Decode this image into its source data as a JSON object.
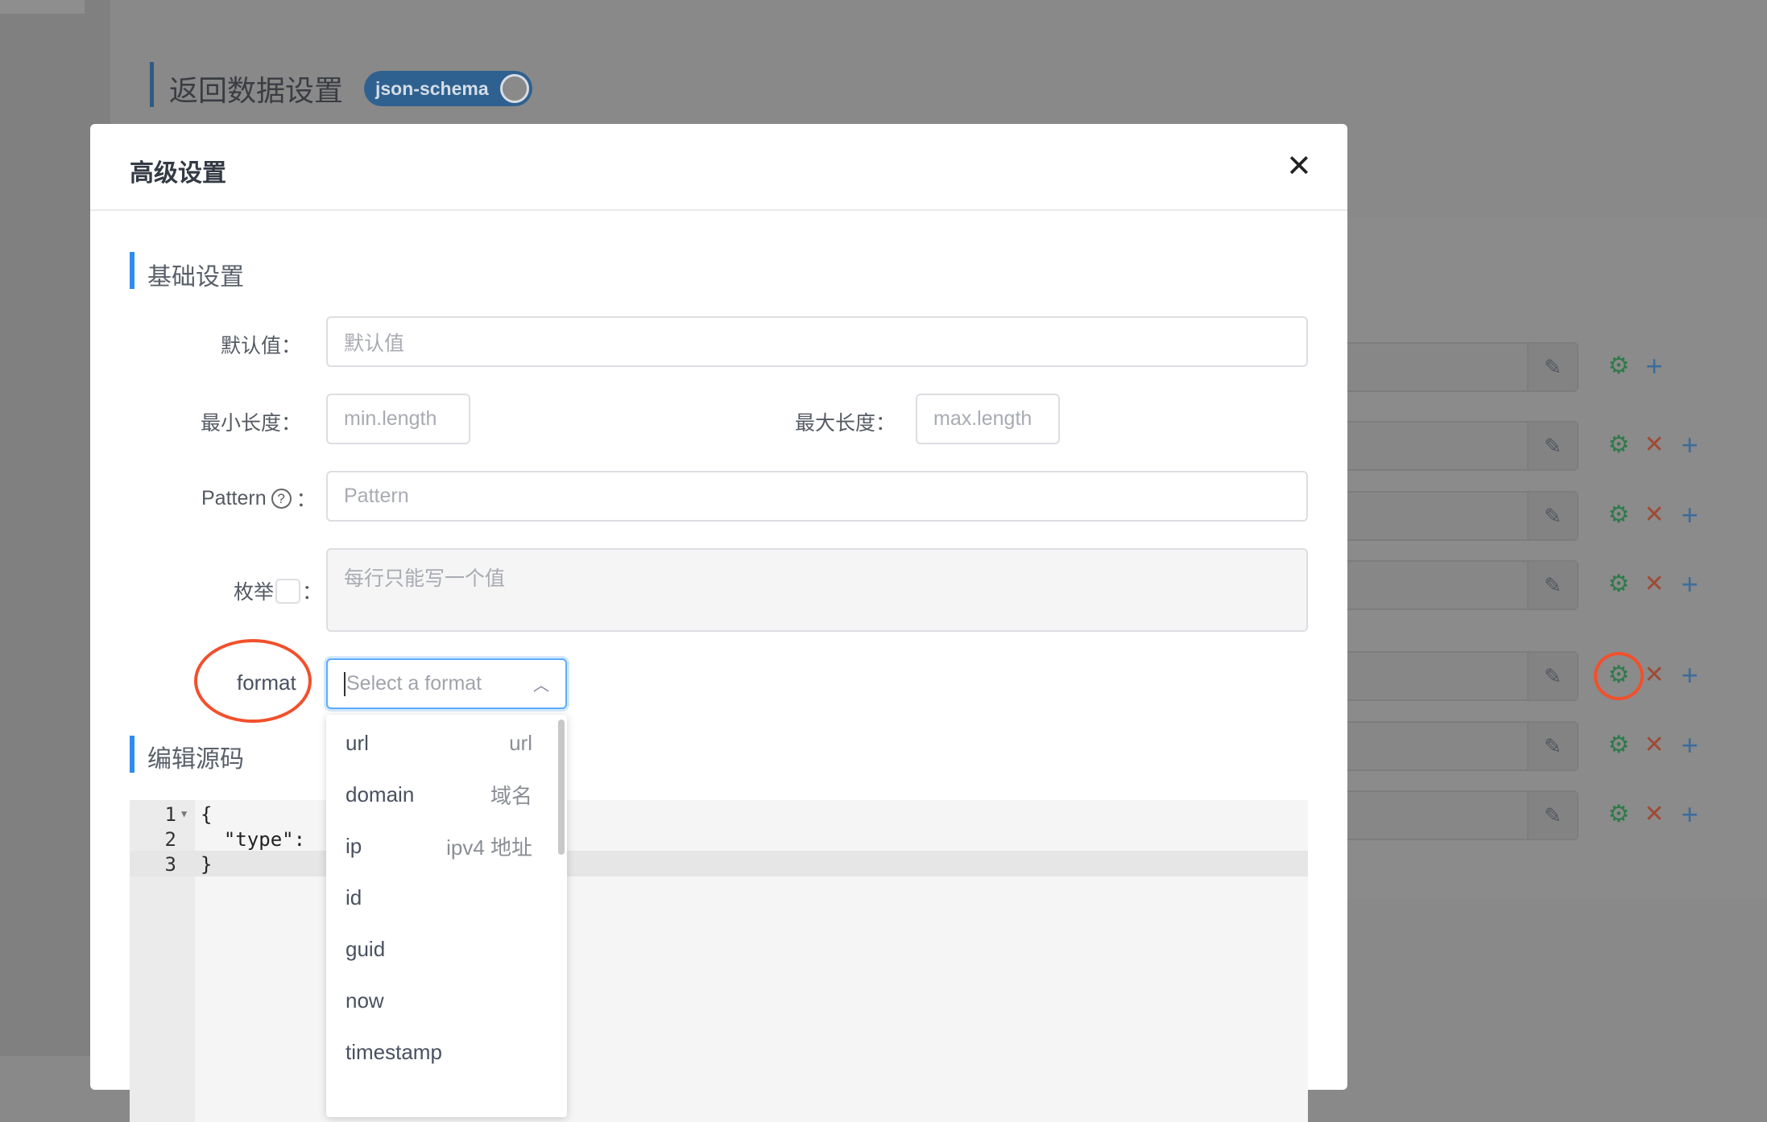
{
  "background": {
    "section_title": "返回数据设置",
    "toggle_label": "json-schema",
    "rows": [
      {
        "actions": [
          "gear-icon",
          "plus-icon"
        ]
      },
      {
        "actions": [
          "gear-icon",
          "close-icon",
          "plus-icon"
        ]
      },
      {
        "actions": [
          "gear-icon",
          "close-icon",
          "plus-icon"
        ]
      },
      {
        "actions": [
          "gear-icon",
          "close-icon",
          "plus-icon"
        ]
      },
      {
        "actions": [
          "gear-icon",
          "close-icon",
          "plus-icon"
        ],
        "highlighted": true
      },
      {
        "actions": [
          "gear-icon",
          "close-icon",
          "plus-icon"
        ]
      },
      {
        "actions": [
          "gear-icon",
          "close-icon",
          "plus-icon"
        ]
      }
    ]
  },
  "modal": {
    "title": "高级设置",
    "close": "✕",
    "basic_section": "基础设置",
    "default_label": "默认值：",
    "default_placeholder": "默认值",
    "min_label": "最小长度：",
    "min_placeholder": "min.length",
    "max_label": "最大长度：",
    "max_placeholder": "max.length",
    "pattern_label": "Pattern",
    "pattern_colon": "：",
    "pattern_placeholder": "Pattern",
    "enum_label": "枚举",
    "enum_colon": "：",
    "enum_placeholder": "每行只能写一个值",
    "format_label": "format",
    "format_placeholder": "Select a format",
    "format_options": [
      {
        "value": "url",
        "desc": "url"
      },
      {
        "value": "domain",
        "desc": "域名"
      },
      {
        "value": "ip",
        "desc": "ipv4 地址"
      },
      {
        "value": "id",
        "desc": ""
      },
      {
        "value": "guid",
        "desc": ""
      },
      {
        "value": "now",
        "desc": ""
      },
      {
        "value": "timestamp",
        "desc": ""
      }
    ],
    "source_section": "编辑源码",
    "code_lines": [
      {
        "num": "1",
        "text": "{"
      },
      {
        "num": "2",
        "text": "  \"type\": "
      },
      {
        "num": "3",
        "text": "}"
      }
    ]
  },
  "colors": {
    "accent": "#2d8cf0",
    "annotation": "#f2502c",
    "gear": "#2f7a4a",
    "delete": "#a04a35",
    "add": "#3d6c9c"
  }
}
